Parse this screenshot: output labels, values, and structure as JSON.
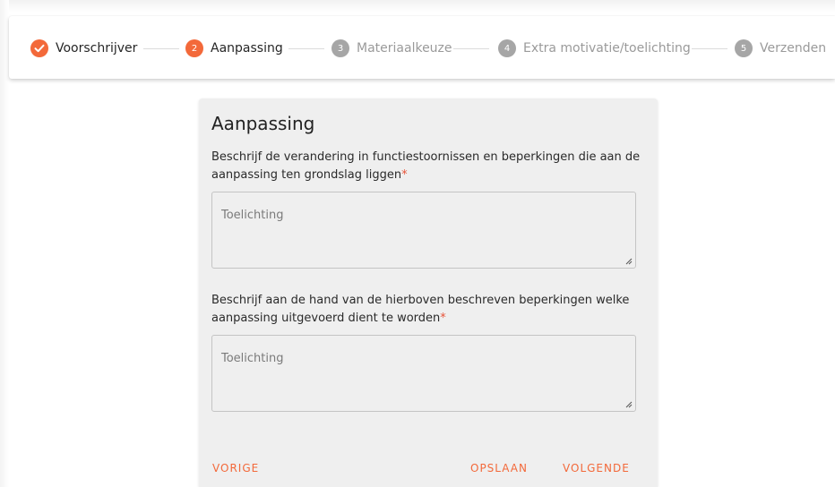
{
  "stepper": {
    "steps": [
      {
        "number": "1",
        "label": "Voorschrijver",
        "state": "done",
        "icon": "check-icon"
      },
      {
        "number": "2",
        "label": "Aanpassing",
        "state": "active"
      },
      {
        "number": "3",
        "label": "Materiaalkeuze",
        "state": "pending"
      },
      {
        "number": "4",
        "label": "Extra motivatie/toelichting",
        "state": "pending"
      },
      {
        "number": "5",
        "label": "Verzenden",
        "state": "pending"
      }
    ]
  },
  "form": {
    "title": "Aanpassing",
    "question1": "Beschrijf de verandering in functiestoornissen en beperkingen die aan de aanpassing ten grondslag liggen",
    "question1_required": "*",
    "field1_placeholder": "Toelichting",
    "question2": "Beschrijf aan de hand van de hierboven beschreven beperkingen welke aanpassing uitgevoerd dient te worden",
    "question2_required": "*",
    "field2_placeholder": "Toelichting"
  },
  "actions": {
    "previous_label": "VORIGE",
    "save_label": "OPSLAAN",
    "next_label": "VOLGENDE"
  },
  "colors": {
    "accent": "#f3693a",
    "pending": "#a6a6a6",
    "card_background": "#efefef"
  }
}
